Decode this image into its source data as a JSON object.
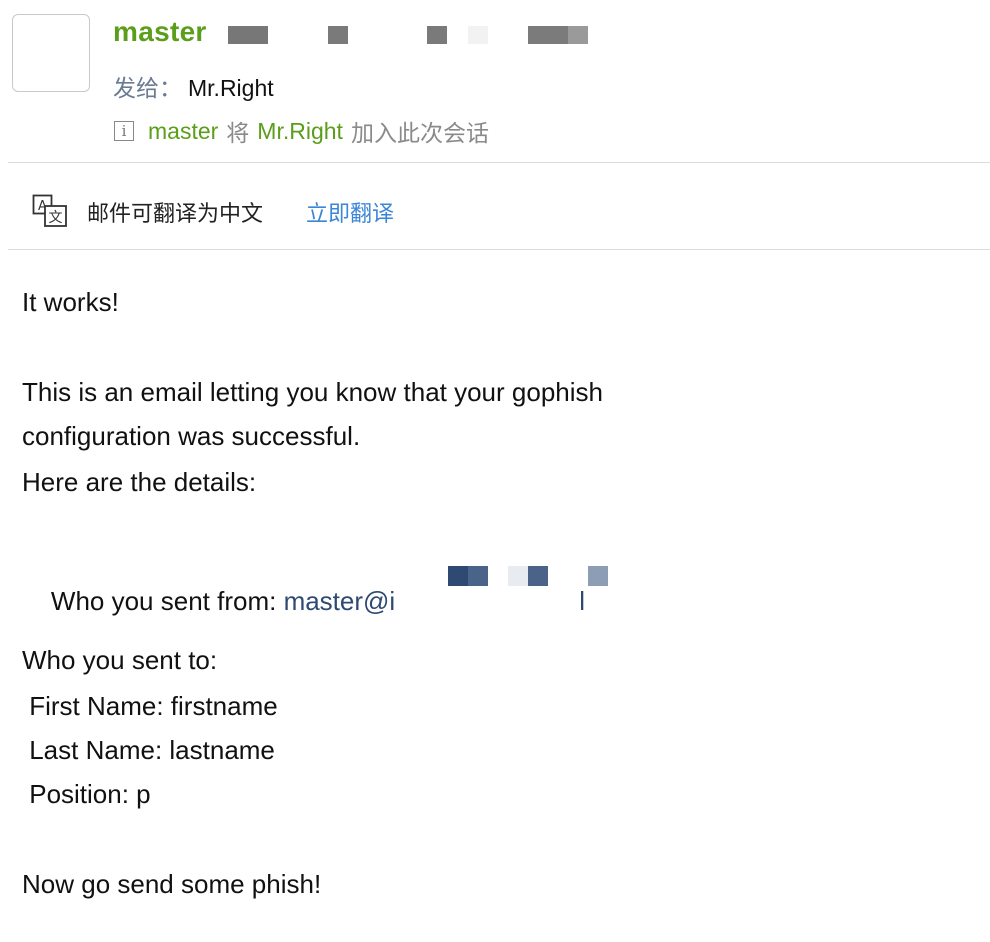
{
  "header": {
    "sender_name": "master",
    "to_label": "发给：",
    "to_name": "Mr.Right",
    "info": {
      "actor": "master",
      "verb": "将",
      "target": "Mr.Right",
      "action": "加入此次会话"
    }
  },
  "translate_bar": {
    "prompt": "邮件可翻译为中文",
    "link": "立即翻译"
  },
  "body": {
    "line1": "It works!",
    "line2": "This is an email letting you know that your gophish",
    "line3": "configuration was successful.",
    "line4": "Here are the details:",
    "from_label": "Who you sent from: ",
    "from_email_start": "master@i",
    "from_email_end": "l",
    "to_heading": "Who you sent to:",
    "first_name": " First Name: firstname",
    "last_name": " Last Name: lastname",
    "position": " Position: p",
    "closing": "Now go send some phish!"
  },
  "colors": {
    "accent_green": "#5a9e1a",
    "link_blue": "#3b86d6",
    "label_gray": "#6a7b93"
  }
}
